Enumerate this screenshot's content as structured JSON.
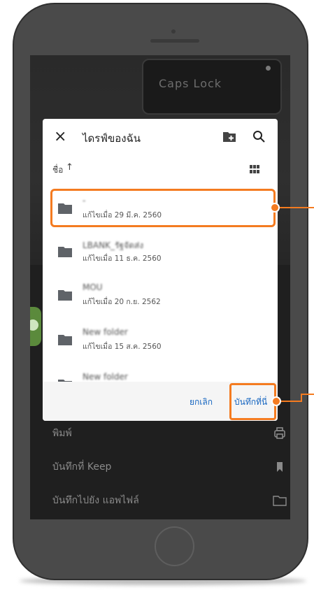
{
  "dialog": {
    "title": "ไดรฟ์ของฉัน",
    "sort_label": "ชื่อ",
    "sort_arrow": "↑",
    "items": [
      {
        "name": "-",
        "meta": "แก้ไขเมื่อ 29 มี.ค. 2560"
      },
      {
        "name": "LBANK_รัฐจัดส่ง",
        "meta": "แก้ไขเมื่อ 11 ธ.ค. 2560"
      },
      {
        "name": "MOU",
        "meta": "แก้ไขเมื่อ 20 ก.ย. 2562"
      },
      {
        "name": "New folder",
        "meta": "แก้ไขเมื่อ 15 ส.ค. 2560"
      },
      {
        "name": "New folder",
        "meta": ""
      }
    ],
    "cancel_label": "ยกเลิก",
    "save_label": "บันทึกที่นี่"
  },
  "background": {
    "keycap_label": "Caps Lock",
    "menu": [
      {
        "label": "พิมพ์",
        "icon": "printer-icon"
      },
      {
        "label": "บันทึกที่ Keep",
        "icon": "bookmark-icon"
      },
      {
        "label": "บันทึกไปยัง แอพไฟล์",
        "icon": "folder-outline-icon"
      }
    ]
  },
  "colors": {
    "highlight": "#f47b20",
    "accent": "#1565c0"
  }
}
